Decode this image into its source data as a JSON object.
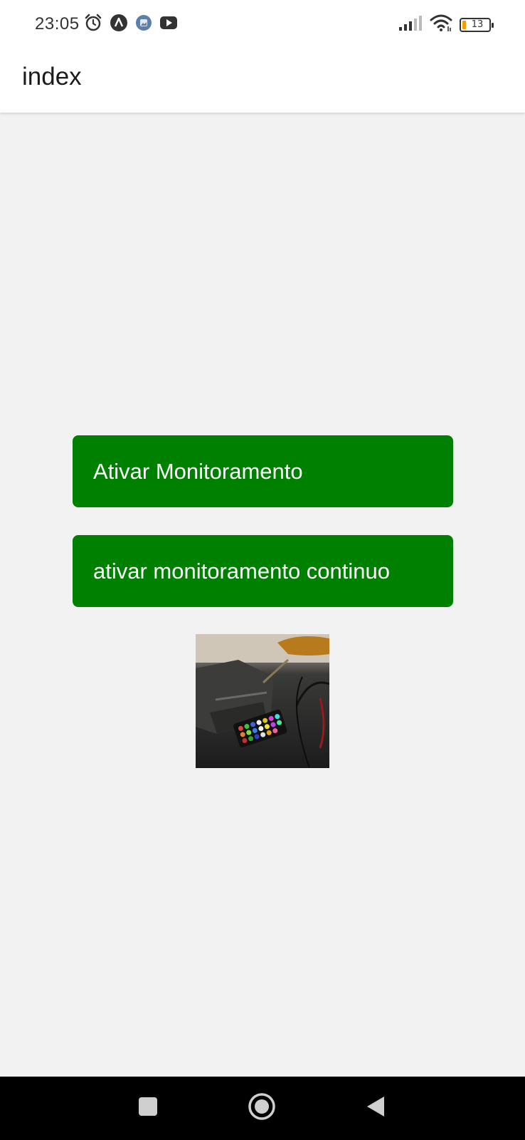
{
  "status_bar": {
    "time": "23:05",
    "battery_level": "13",
    "icons_left": [
      "alarm-icon",
      "navigation-arrow-icon",
      "gallery-notification-icon",
      "youtube-icon"
    ],
    "icons_right": [
      "signal-icon",
      "wifi-icon",
      "battery-icon"
    ]
  },
  "header": {
    "title": "index"
  },
  "buttons": {
    "activate_label": "Ativar Monitoramento",
    "activate_continuous_label": "ativar monitoramento continuo",
    "color": "#008000"
  },
  "nav_bar": {
    "icons": [
      "recents-icon",
      "home-icon",
      "back-icon"
    ]
  }
}
